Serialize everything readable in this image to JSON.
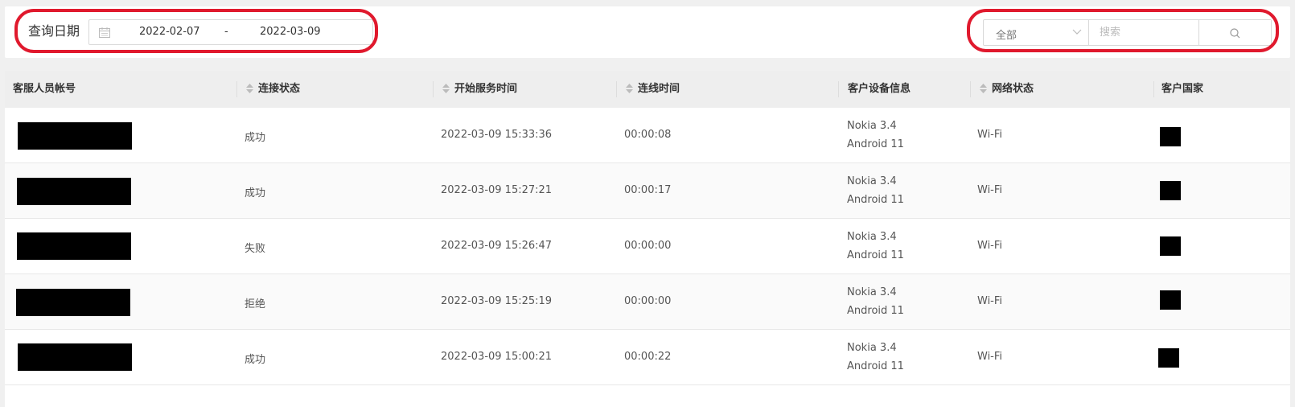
{
  "filter": {
    "date_label": "查询日期",
    "date_start": "2022-02-07",
    "date_separator": "-",
    "date_end": "2022-03-09",
    "select_value": "全部",
    "search_placeholder": "搜索",
    "highlight_color": "#e0192d"
  },
  "table": {
    "headers": {
      "agent_account": "客服人员帐号",
      "connection_status": "连接状态",
      "service_start_time": "开始服务时间",
      "connected_duration": "连线时间",
      "customer_device": "客户设备信息",
      "network_status": "网络状态",
      "customer_country": "客户国家"
    },
    "rows": [
      {
        "status": "成功",
        "start_time": "2022-03-09 15:33:36",
        "duration": "00:00:08",
        "device_model": "Nokia 3.4",
        "device_os": "Android 11",
        "network": "Wi-Fi"
      },
      {
        "status": "成功",
        "start_time": "2022-03-09 15:27:21",
        "duration": "00:00:17",
        "device_model": "Nokia 3.4",
        "device_os": "Android 11",
        "network": "Wi-Fi"
      },
      {
        "status": "失败",
        "start_time": "2022-03-09 15:26:47",
        "duration": "00:00:00",
        "device_model": "Nokia 3.4",
        "device_os": "Android 11",
        "network": "Wi-Fi"
      },
      {
        "status": "拒绝",
        "start_time": "2022-03-09 15:25:19",
        "duration": "00:00:00",
        "device_model": "Nokia 3.4",
        "device_os": "Android 11",
        "network": "Wi-Fi"
      },
      {
        "status": "成功",
        "start_time": "2022-03-09 15:00:21",
        "duration": "00:00:22",
        "device_model": "Nokia 3.4",
        "device_os": "Android 11",
        "network": "Wi-Fi"
      }
    ]
  },
  "icons": {
    "calendar": "calendar-icon",
    "dropdown": "chevron-down-icon",
    "search": "search-icon",
    "sort": "sort-icon"
  }
}
